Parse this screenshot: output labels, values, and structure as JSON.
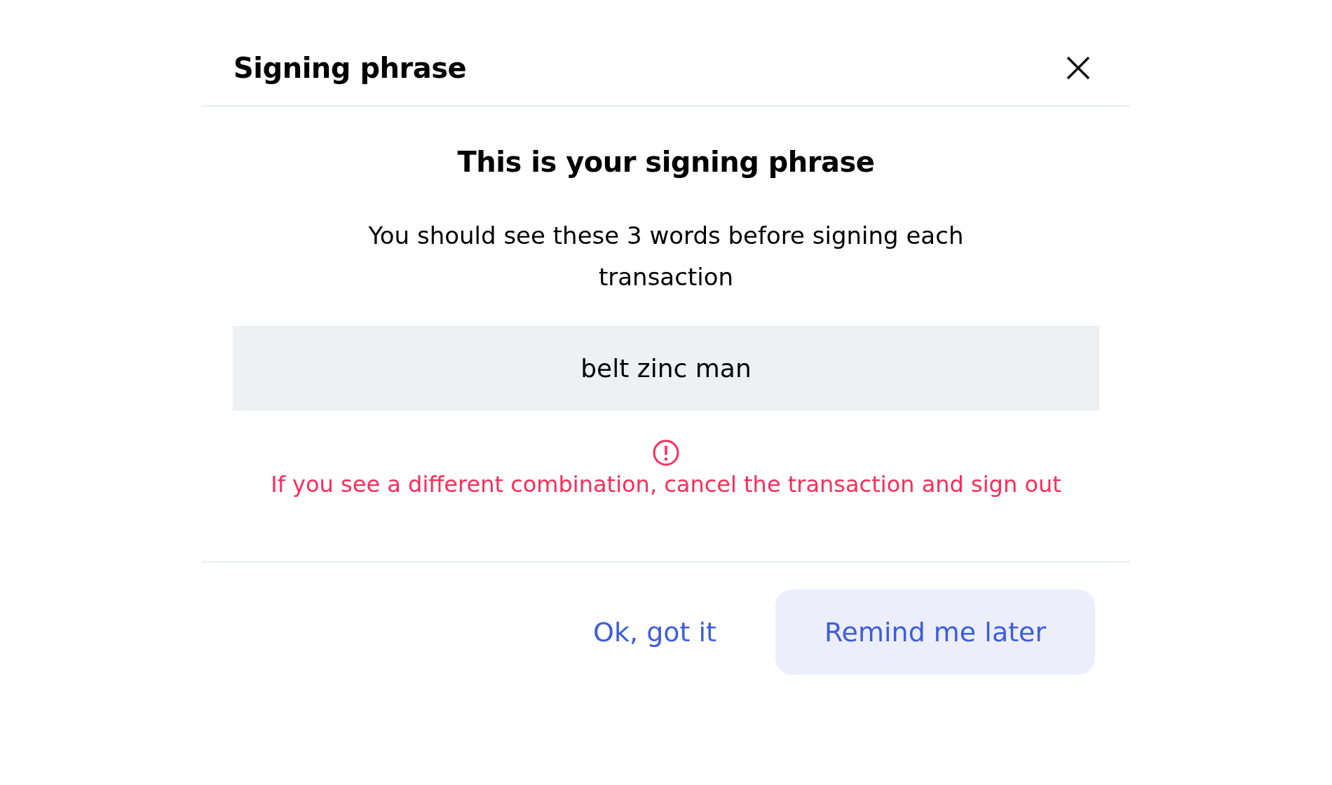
{
  "dialog": {
    "title": "Signing phrase",
    "heading": "This is your signing phrase",
    "description": "You should see these 3 words before signing each transaction",
    "phrase": "belt zinc man",
    "warning": "If you see a different combination, cancel the transaction and sign out"
  },
  "buttons": [
    {
      "label": "Ok, got it",
      "kind": "text"
    },
    {
      "label": "Remind me later",
      "kind": "filled"
    }
  ]
}
